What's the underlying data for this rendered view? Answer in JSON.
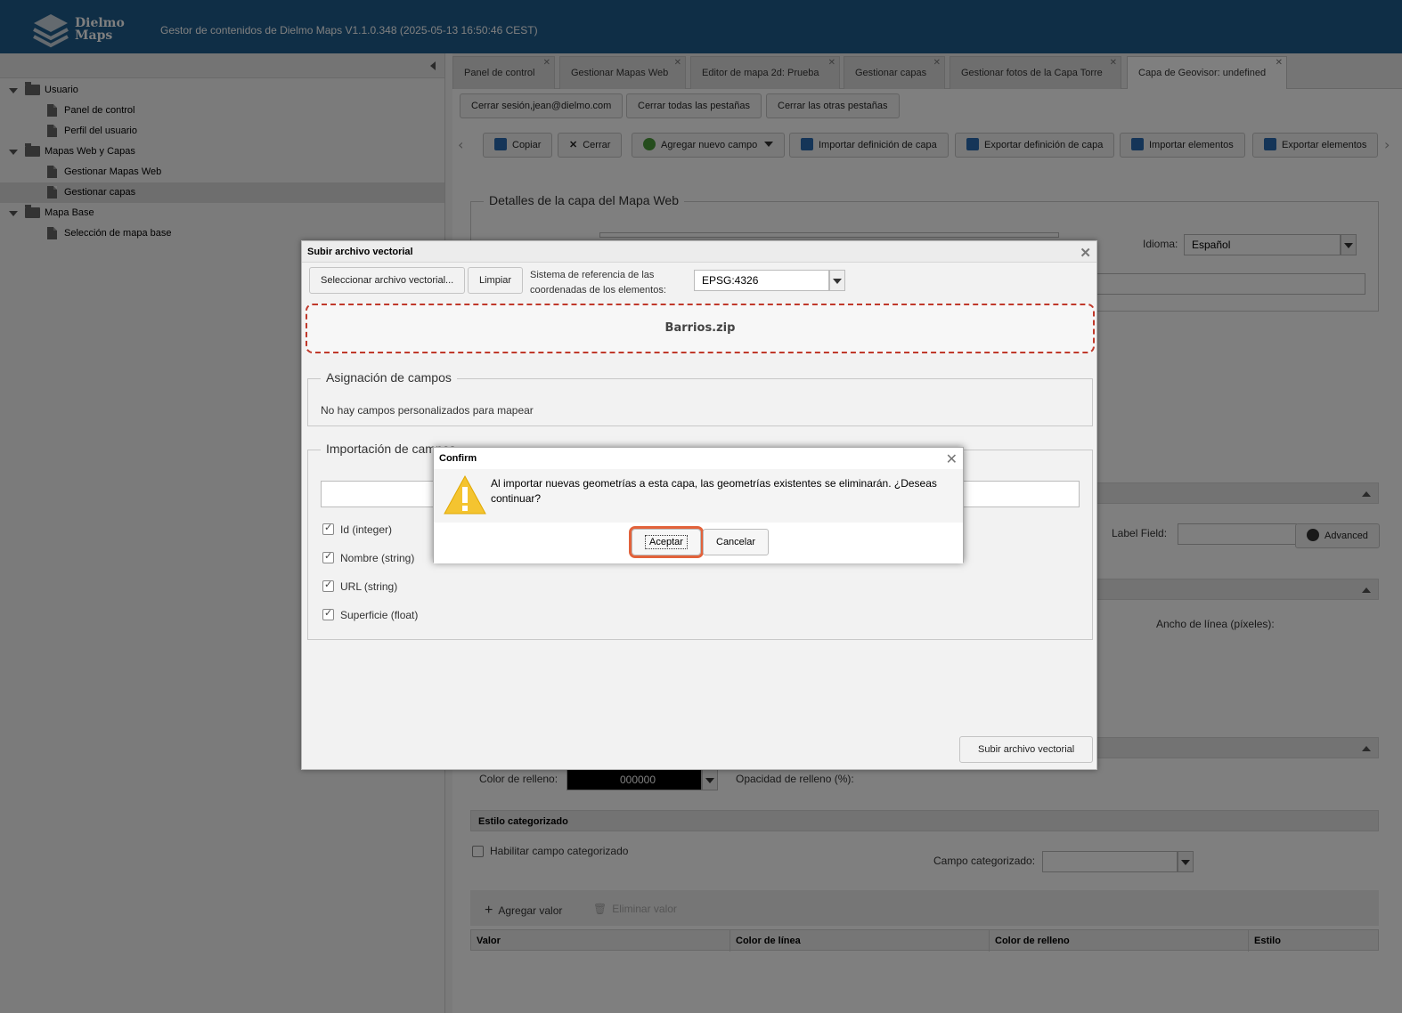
{
  "header": {
    "logo_line1": "Dielmo",
    "logo_line2": "Maps",
    "title": "Gestor de contenidos de Dielmo Maps V1.1.0.348 (2025-05-13 16:50:46 CEST)"
  },
  "tree": {
    "items": [
      {
        "label": "Usuario",
        "type": "folder"
      },
      {
        "label": "Panel de control",
        "type": "file"
      },
      {
        "label": "Perfil del usuario",
        "type": "file"
      },
      {
        "label": "Mapas Web y Capas",
        "type": "folder"
      },
      {
        "label": "Gestionar Mapas Web",
        "type": "file"
      },
      {
        "label": "Gestionar capas",
        "type": "file"
      },
      {
        "label": "Mapa Base",
        "type": "folder"
      },
      {
        "label": "Selección de mapa base",
        "type": "file"
      }
    ]
  },
  "tabs": [
    {
      "label": "Panel de control"
    },
    {
      "label": "Gestionar Mapas Web"
    },
    {
      "label": "Editor de mapa 2d: Prueba"
    },
    {
      "label": "Gestionar capas"
    },
    {
      "label": "Gestionar fotos de la Capa Torre"
    },
    {
      "label": "Capa de Geovisor: undefined"
    }
  ],
  "session": {
    "logout": "Cerrar sesión,jean@dielmo.com",
    "close_all": "Cerrar todas las pestañas",
    "close_others": "Cerrar las otras pestañas"
  },
  "toolbar": {
    "copy": "Copiar",
    "close": "Cerrar",
    "add_field": "Agregar nuevo campo",
    "import_def": "Importar definición de capa",
    "export_def": "Exportar definición de capa",
    "import_el": "Importar elementos",
    "export_el": "Exportar elementos"
  },
  "details": {
    "legend": "Detalles de la capa del Mapa Web",
    "language_label": "Idioma:",
    "language_value": "Español"
  },
  "style": {
    "label_field": "Label Field:",
    "advanced": "Advanced",
    "line_width": "Ancho de línea (píxeles):",
    "fill_color_label": "Color de relleno:",
    "fill_color_value": "000000",
    "fill_opacity": "Opacidad de relleno (%):",
    "categorized_header": "Estilo categorizado",
    "enable_categorized": "Habilitar campo categorizado",
    "categorized_field": "Campo categorizado:",
    "add_value": "Agregar valor",
    "remove_value": "Eliminar valor",
    "columns": [
      "Valor",
      "Color de línea",
      "Color de relleno",
      "Estilo"
    ]
  },
  "upload": {
    "title": "Subir archivo vectorial",
    "select_btn": "Seleccionar archivo vectorial...",
    "clear_btn": "Limpiar",
    "crs_label_1": "Sistema de referencia de las",
    "crs_label_2": "coordenadas de los elementos:",
    "crs_value": "EPSG:4326",
    "file_name": "Barrios.zip",
    "mapping_legend": "Asignación de campos",
    "no_custom_fields": "No hay campos personalizados para mapear",
    "import_legend": "Importación de campos",
    "fields": [
      {
        "label": "Id (integer)"
      },
      {
        "label": "Nombre (string)"
      },
      {
        "label": "URL (string)"
      },
      {
        "label": "Superficie (float)"
      }
    ],
    "submit": "Subir archivo vectorial"
  },
  "confirm": {
    "title": "Confirm",
    "message": "Al importar nuevas geometrías a esta capa, las geometrías existentes se eliminarán. ¿Deseas continuar?",
    "accept": "Aceptar",
    "cancel": "Cancelar"
  },
  "colors": {
    "header": "#1f5c8c",
    "focus_ring": "#e2623b",
    "drop_border": "#c0392b",
    "warning": "#f4c430"
  }
}
